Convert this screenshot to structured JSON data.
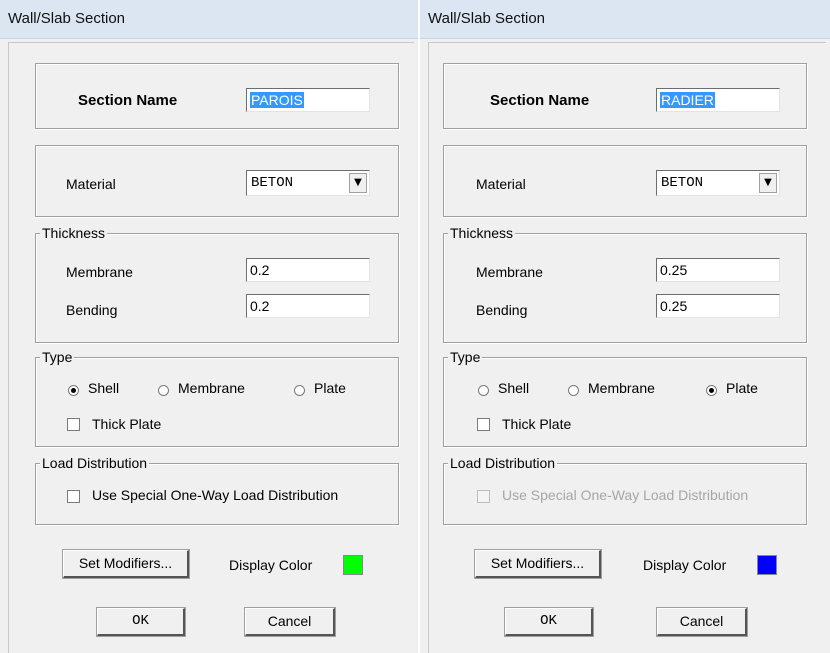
{
  "dialogs": [
    {
      "title": "Wall/Slab Section",
      "section_name_label": "Section Name",
      "section_name_value": "PAROIS",
      "material_label": "Material",
      "material_value": "BETON",
      "thickness_legend": "Thickness",
      "membrane_label": "Membrane",
      "membrane_value": "0.2",
      "bending_label": "Bending",
      "bending_value": "0.2",
      "type_legend": "Type",
      "shell_label": "Shell",
      "membrane_type_label": "Membrane",
      "plate_label": "Plate",
      "selected_type": "Shell",
      "thick_plate_label": "Thick Plate",
      "thick_plate_checked": false,
      "load_distribution_legend": "Load Distribution",
      "load_distribution_label": "Use Special One-Way Load Distribution",
      "load_distribution_enabled": true,
      "set_modifiers_label": "Set Modifiers...",
      "display_color_label": "Display Color",
      "display_color": "#00ff00",
      "ok_label": "OK",
      "cancel_label": "Cancel"
    },
    {
      "title": "Wall/Slab Section",
      "section_name_label": "Section Name",
      "section_name_value": "RADIER",
      "material_label": "Material",
      "material_value": "BETON",
      "thickness_legend": "Thickness",
      "membrane_label": "Membrane",
      "membrane_value": "0.25",
      "bending_label": "Bending",
      "bending_value": "0.25",
      "type_legend": "Type",
      "shell_label": "Shell",
      "membrane_type_label": "Membrane",
      "plate_label": "Plate",
      "selected_type": "Plate",
      "thick_plate_label": "Thick Plate",
      "thick_plate_checked": false,
      "load_distribution_legend": "Load Distribution",
      "load_distribution_label": "Use Special One-Way Load Distribution",
      "load_distribution_enabled": false,
      "set_modifiers_label": "Set Modifiers...",
      "display_color_label": "Display Color",
      "display_color": "#0000ff",
      "ok_label": "OK",
      "cancel_label": "Cancel"
    }
  ]
}
